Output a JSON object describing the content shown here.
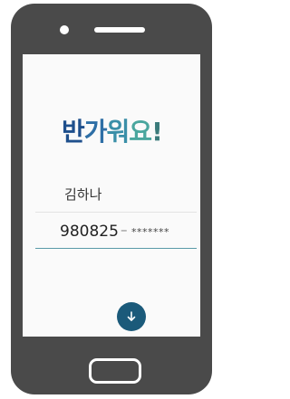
{
  "screen": {
    "title": "반가워요!",
    "title_colors": [
      "#1e4f8c",
      "#2e6fa6",
      "#3a8fa8",
      "#4aa69e",
      "#3a7a7a"
    ],
    "name": {
      "value": "김하나"
    },
    "resident_id": {
      "front": "980825",
      "separator": "–",
      "back_masked": "*******"
    },
    "next_button": {
      "icon": "arrow-down-icon",
      "color": "#1b5a7a"
    }
  },
  "device": {
    "body_color": "#4a4a4a"
  }
}
